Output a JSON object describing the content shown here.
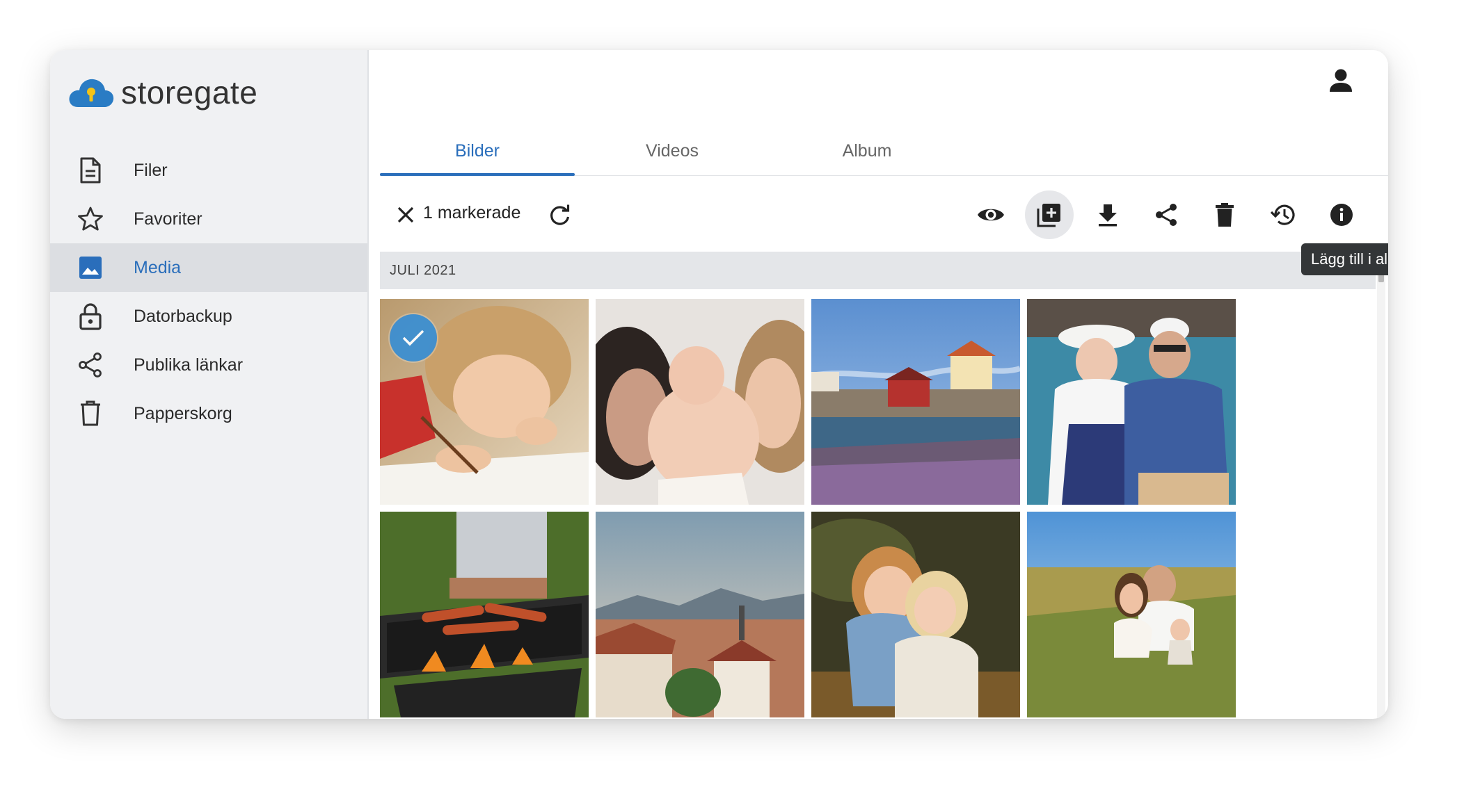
{
  "brand": {
    "name": "storegate"
  },
  "sidebar": {
    "items": [
      {
        "label": "Filer",
        "icon": "file-icon"
      },
      {
        "label": "Favoriter",
        "icon": "star-icon"
      },
      {
        "label": "Media",
        "icon": "image-icon",
        "active": true
      },
      {
        "label": "Datorbackup",
        "icon": "lock-icon"
      },
      {
        "label": "Publika länkar",
        "icon": "share-icon"
      },
      {
        "label": "Papperskorg",
        "icon": "trash-icon"
      }
    ]
  },
  "tabs": [
    {
      "label": "Bilder",
      "active": true
    },
    {
      "label": "Videos"
    },
    {
      "label": "Album"
    }
  ],
  "toolbar": {
    "selection_label": "1 markerade",
    "actions": [
      "eye-icon",
      "add-to-album-icon",
      "download-icon",
      "share-icon",
      "trash-icon",
      "history-icon",
      "info-icon"
    ],
    "tooltip": "Lägg till i album..."
  },
  "gallery": {
    "group_label": "JULI 2021",
    "photos": [
      {
        "subject": "child drawing",
        "selected": true
      },
      {
        "subject": "family with baby"
      },
      {
        "subject": "coastal village"
      },
      {
        "subject": "elderly couple by water"
      },
      {
        "subject": "sausages on grill"
      },
      {
        "subject": "city rooftops"
      },
      {
        "subject": "two girls hugging"
      },
      {
        "subject": "family in field"
      }
    ]
  },
  "colors": {
    "accent": "#2a6ebb",
    "sidebar_bg": "#f0f1f3",
    "tooltip_bg": "#333638"
  }
}
